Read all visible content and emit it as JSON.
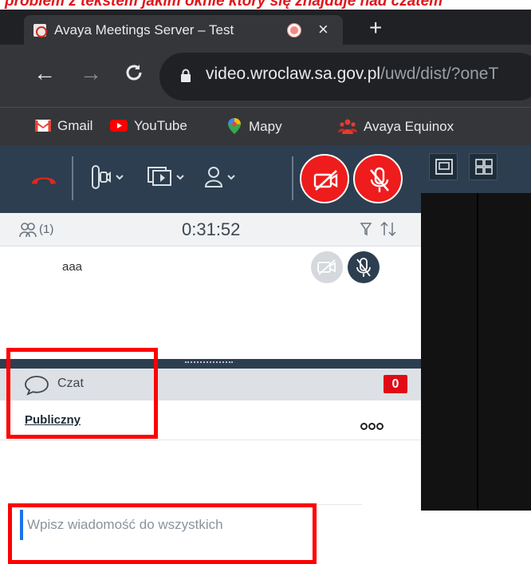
{
  "banner": {
    "text": "problem z tekstem jakim oknie który się znajduje nad czatem"
  },
  "browser": {
    "tab_title": "Avaya Meetings Server – Test",
    "tab_close": "×",
    "new_tab": "+",
    "url_host": "video.wroclaw.sa.gov.pl",
    "url_path": "/uwd/dist/?oneT",
    "bookmarks": [
      "Gmail",
      "YouTube",
      "Mapy",
      "Avaya Equinox"
    ],
    "icons": [
      "back-arrow-icon",
      "forward-arrow-icon",
      "reload-icon",
      "lock-icon"
    ]
  },
  "participants": {
    "count_label": "(1)",
    "timer": "0:31:52",
    "items": [
      {
        "name": "aaa"
      }
    ]
  },
  "chat": {
    "label": "Czat",
    "badge": "0",
    "active_tab": "Publiczny",
    "input_placeholder": "Wpisz wiadomość do wszystkich"
  },
  "colors": {
    "control_bar": "#2c3e50",
    "danger_red": "#ee1c1c",
    "chrome_dark": "#202124",
    "chrome_toolbar": "#35363a",
    "annotation_red": "#ff0000"
  }
}
